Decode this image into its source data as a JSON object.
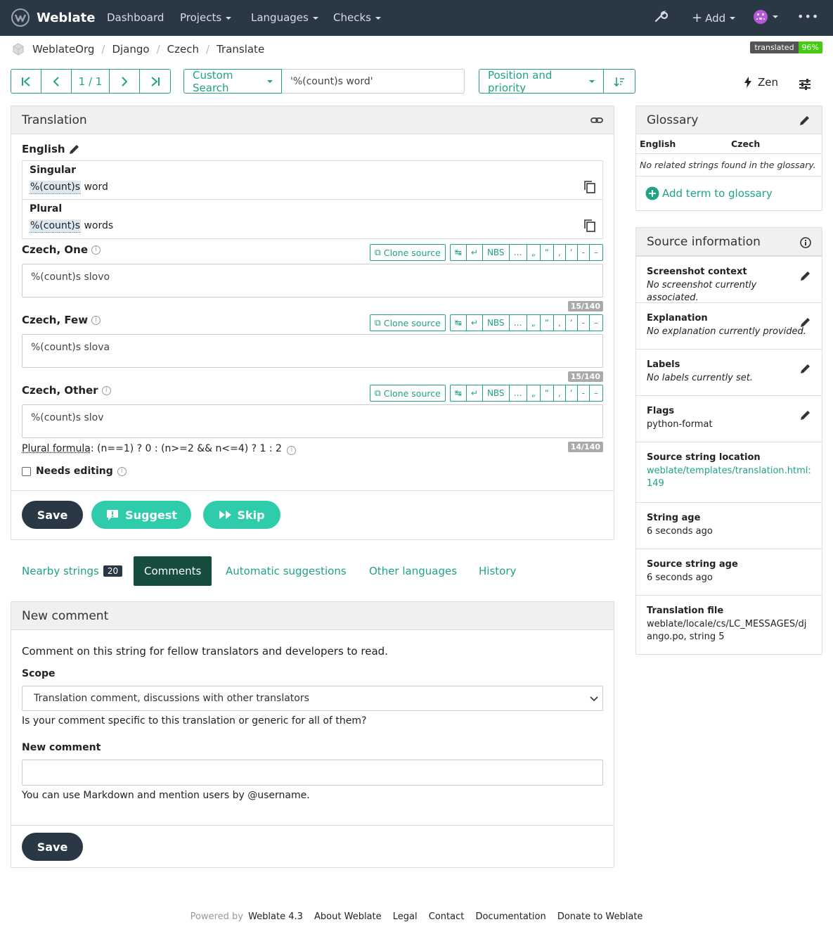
{
  "nav": {
    "brand": "Weblate",
    "items": [
      "Dashboard",
      "Projects",
      "Languages",
      "Checks"
    ],
    "add_label": "Add",
    "more": "•••"
  },
  "breadcrumb": [
    "WeblateOrg",
    "Django",
    "Czech",
    "Translate"
  ],
  "status_badge": {
    "label": "translated",
    "value": "96%"
  },
  "pager": {
    "count": "1 / 1"
  },
  "search": {
    "mode": "Custom Search",
    "query": "'%(count)s word'"
  },
  "sort": {
    "label": "Position and priority"
  },
  "zen_label": "Zen",
  "translation": {
    "title": "Translation",
    "source_lang": "English",
    "source": [
      {
        "label": "Singular",
        "placeholder": "%(count)s",
        "rest": " word"
      },
      {
        "label": "Plural",
        "placeholder": "%(count)s",
        "rest": " words"
      }
    ],
    "clone_label": "Clone source",
    "keys": [
      "↹",
      "↵",
      "NBS",
      "…",
      "„",
      "“",
      ",",
      "‘",
      "-",
      "–"
    ],
    "forms": [
      {
        "label": "Czech, One",
        "value": "%(count)s slovo",
        "counter": "15/140"
      },
      {
        "label": "Czech, Few",
        "value": "%(count)s slova",
        "counter": "15/140"
      },
      {
        "label": "Czech, Other",
        "value": "%(count)s slov",
        "counter": "14/140"
      }
    ],
    "plural_formula_label": "Plural formula",
    "plural_formula": ": (n==1) ? 0 : (n>=2 && n<=4) ? 1 : 2",
    "needs_editing": "Needs editing",
    "save": "Save",
    "suggest": "Suggest",
    "skip": "Skip"
  },
  "tabs": {
    "nearby": "Nearby strings",
    "nearby_count": "20",
    "comments": "Comments",
    "automatic": "Automatic suggestions",
    "other": "Other languages",
    "history": "History"
  },
  "comment": {
    "title": "New comment",
    "intro": "Comment on this string for fellow translators and developers to read.",
    "scope_label": "Scope",
    "scope_value": "Translation comment, discussions with other translators",
    "scope_help": "Is your comment specific to this translation or generic for all of them?",
    "new_label": "New comment",
    "markdown_help": "You can use Markdown and mention users by @username.",
    "save": "Save"
  },
  "glossary": {
    "title": "Glossary",
    "col_source": "English",
    "col_target": "Czech",
    "empty": "No related strings found in the glossary.",
    "add": "Add term to glossary"
  },
  "source_info": {
    "title": "Source information",
    "rows": [
      {
        "k": "Screenshot context",
        "v": "No screenshot currently associated."
      },
      {
        "k": "Explanation",
        "v": "No explanation currently provided."
      },
      {
        "k": "Labels",
        "v": "No labels currently set."
      },
      {
        "k": "Flags",
        "v": "python-format"
      },
      {
        "k": "Source string location",
        "v": "weblate/templates/translation.html:149"
      },
      {
        "k": "String age",
        "v": "6 seconds ago"
      },
      {
        "k": "Source string age",
        "v": "6 seconds ago"
      },
      {
        "k": "Translation file",
        "v": "weblate/locale/cs/LC_MESSAGES/django.po, string 5"
      }
    ]
  },
  "footer": {
    "powered": "Powered by",
    "version": "Weblate 4.3",
    "links": [
      "About Weblate",
      "Legal",
      "Contact",
      "Documentation",
      "Donate to Weblate"
    ]
  },
  "colors": {
    "accent": "#1fa385",
    "navbar": "#2a3744",
    "suggest": "#2eccaa"
  }
}
